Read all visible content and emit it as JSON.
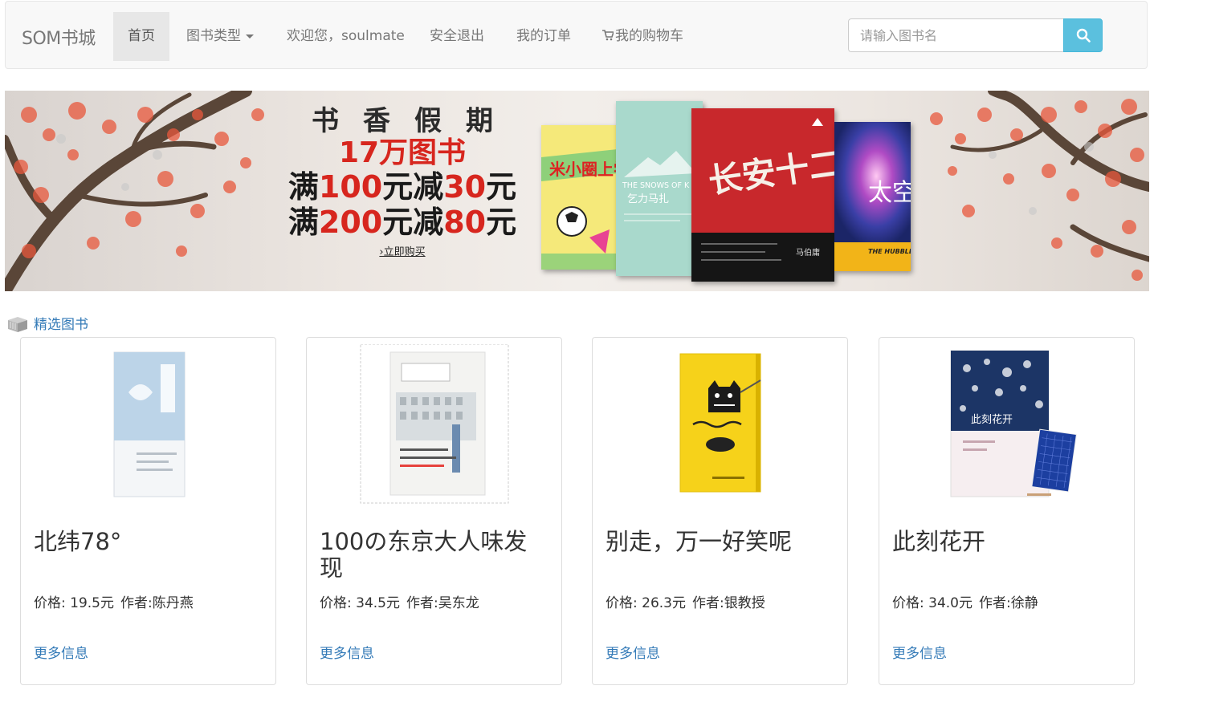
{
  "navbar": {
    "brand": "SOM书城",
    "items": [
      {
        "label": "首页",
        "active": true
      },
      {
        "label": "图书类型",
        "dropdown": true
      },
      {
        "label": "欢迎您，soulmate"
      },
      {
        "label": "安全退出"
      },
      {
        "label": "我的订单"
      },
      {
        "label": "我的购物车",
        "icon": "shopping-cart-icon"
      }
    ],
    "search": {
      "placeholder": "请输入图书名",
      "value": "",
      "button_icon": "search-icon"
    }
  },
  "banner": {
    "line1": "书香假期",
    "line2": "17万图书",
    "line3_pre": "满",
    "line3_amt": "100",
    "line3_mid": "元减",
    "line3_amt2": "30",
    "line3_post": "元",
    "line4_pre": "满",
    "line4_amt": "200",
    "line4_mid": "元减",
    "line4_amt2": "80",
    "line4_post": "元",
    "cta": "›立即购买",
    "book_texts": [
      "米小圈上学",
      "THE SNOWS OF K",
      "乞力马扎",
      "长安十二时辰",
      "马伯庸",
      "太空",
      "THE HUBBLE COSMOS"
    ]
  },
  "section": {
    "title": "精选图书",
    "icon": "books-icon"
  },
  "books": [
    {
      "title": "北纬78°",
      "price_label": "价格: 19.5元",
      "author_label": "作者:陈丹燕",
      "more": "更多信息",
      "cover_color": "#bcd4e8"
    },
    {
      "title": "100の东京大人味发现",
      "price_label": "价格: 34.5元",
      "author_label": "作者:吴东龙",
      "more": "更多信息",
      "cover_color": "#eef0ee"
    },
    {
      "title": "别走，万一好笑呢",
      "price_label": "价格: 26.3元",
      "author_label": "作者:银教授",
      "more": "更多信息",
      "cover_color": "#f6d21a"
    },
    {
      "title": "此刻花开",
      "price_label": "价格: 34.0元",
      "author_label": "作者:徐静",
      "more": "更多信息",
      "cover_color": "#1c3566"
    }
  ],
  "colors": {
    "link": "#337ab7",
    "search_button": "#5bc0de",
    "promo_red": "#d7261e"
  }
}
